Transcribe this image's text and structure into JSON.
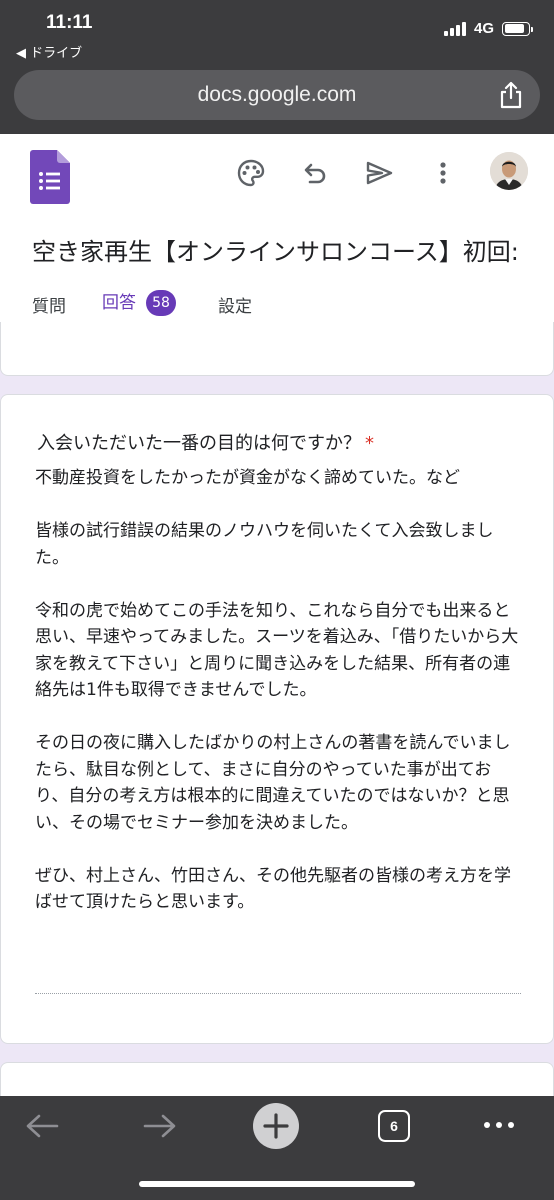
{
  "status_bar": {
    "time": "11:11",
    "back_app": "◀ ドライブ",
    "network": "4G"
  },
  "browser": {
    "url": "docs.google.com"
  },
  "header": {
    "icons": [
      "palette-icon",
      "undo-icon",
      "send-icon",
      "more-vert-icon"
    ],
    "form_title": "空き家再生【オンラインサロンコース】初回:",
    "tabs": [
      {
        "label": "質問"
      },
      {
        "label": "回答",
        "badge": "58"
      },
      {
        "label": "設定"
      }
    ],
    "accent_color": "#673ab7"
  },
  "response_card": {
    "question": "入会いただいた一番の目的は何ですか？",
    "required_mark": "*",
    "answer_paragraphs": [
      "不動産投資をしたかったが資金がなく諦めていた。など",
      "皆様の試行錯誤の結果のノウハウを伺いたくて入会致しました。",
      "令和の虎で始めてこの手法を知り、これなら自分でも出来ると思い、早速やってみました。スーツを着込み、「借りたいから大家を教えて下さい」と周りに聞き込みをした結果、所有者の連絡先は1件も取得できませんでした。",
      "その日の夜に購入したばかりの村上さんの著書を読んでいましたら、駄目な例として、まさに自分のやっていた事が出ており、自分の考え方は根本的に間違えていたのではないか？と思い、その場でセミナー参加を決めました。",
      "ぜひ、村上さん、竹田さん、その他先駆者の皆様の考え方を学ばせて頂けたらと思います。"
    ]
  },
  "bottom_toolbar": {
    "tab_count": "6",
    "icons": [
      "back-arrow-icon",
      "forward-arrow-icon",
      "new-tab-plus-icon",
      "tabs-icon",
      "more-icon"
    ]
  }
}
